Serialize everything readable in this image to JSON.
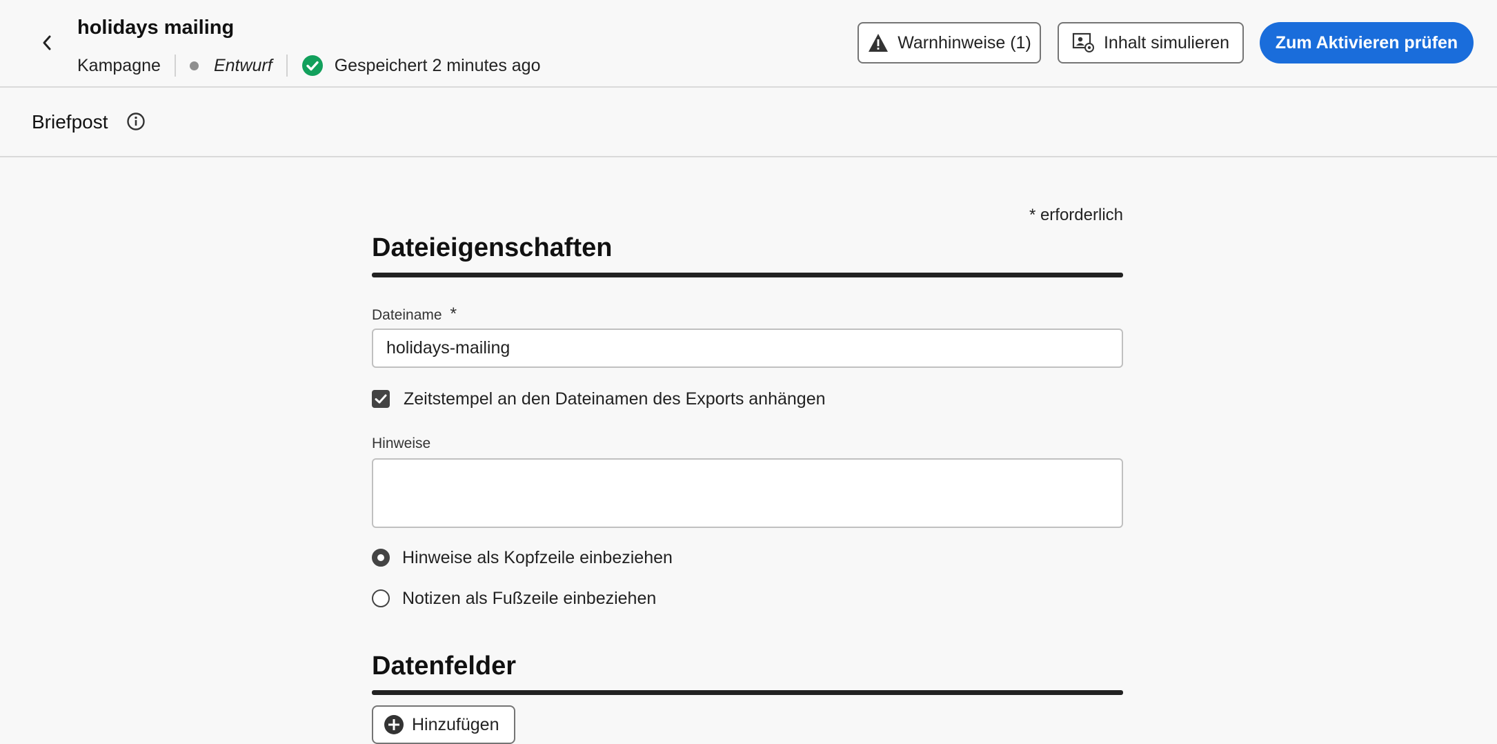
{
  "header": {
    "title": "holidays mailing",
    "type_label": "Kampagne",
    "status": "Entwurf",
    "saved_text": "Gespeichert 2 minutes ago",
    "warnings_label": "Warnhinweise (1)",
    "simulate_label": "Inhalt simulieren",
    "primary_label": "Zum Aktivieren prüfen"
  },
  "subbar": {
    "label": "Briefpost"
  },
  "form": {
    "required_note": "* erforderlich",
    "section_file": "Dateieigenschaften",
    "filename_label": "Dateiname",
    "filename_required_mark": "*",
    "filename_value": "holidays-mailing",
    "timestamp_checkbox_label": "Zeitstempel an den Dateinamen des Exports anhängen",
    "timestamp_checked": true,
    "notes_label": "Hinweise",
    "notes_value": "",
    "radio_header_label": "Hinweise als Kopfzeile einbeziehen",
    "radio_footer_label": "Notizen als Fußzeile einbeziehen",
    "radio_selected": "header",
    "section_fields": "Datenfelder",
    "add_label": "Hinzufügen"
  },
  "colors": {
    "primary": "#1a6ddb",
    "success": "#12a05c",
    "background": "#f8f8f8"
  },
  "icons": {
    "back": "chevron-left-icon",
    "status_dot": "status-dot-icon",
    "saved": "check-circle-icon",
    "warning": "warning-triangle-icon",
    "simulate": "preview-icon",
    "info": "info-icon",
    "add": "add-circle-icon"
  }
}
